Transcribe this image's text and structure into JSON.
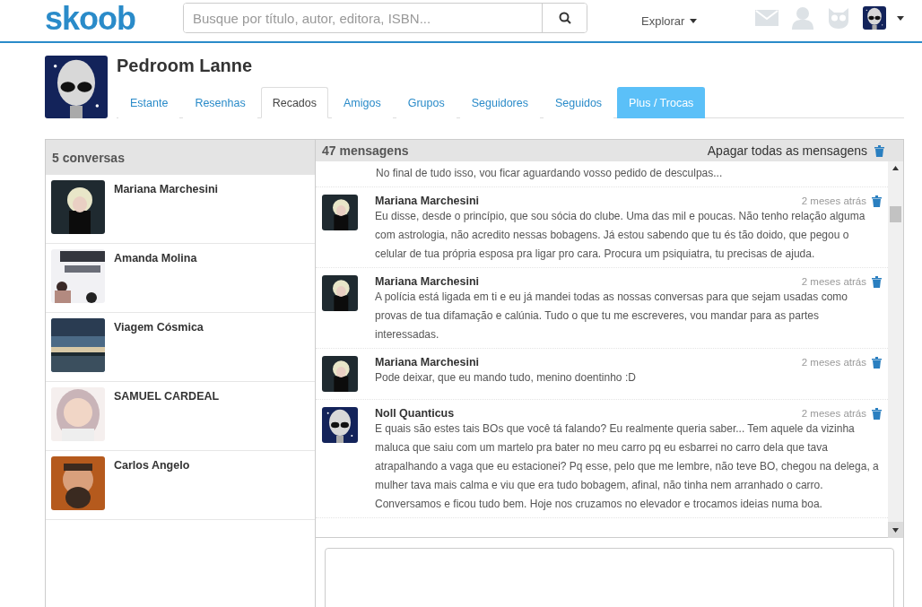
{
  "header": {
    "logo": "skoob",
    "search": {
      "placeholder": "Busque por título, autor, editora, ISBN..."
    },
    "explore": "Explorar"
  },
  "profile": {
    "name": "Pedroom Lanne"
  },
  "tabs": [
    {
      "label": "Estante",
      "selected": false,
      "kind": "normal"
    },
    {
      "label": "Resenhas",
      "selected": false,
      "kind": "normal"
    },
    {
      "label": "Recados",
      "selected": true,
      "kind": "normal"
    },
    {
      "label": "Amigos",
      "selected": false,
      "kind": "normal"
    },
    {
      "label": "Grupos",
      "selected": false,
      "kind": "normal"
    },
    {
      "label": "Seguidores",
      "selected": false,
      "kind": "normal"
    },
    {
      "label": "Seguidos",
      "selected": false,
      "kind": "normal"
    },
    {
      "label": "Plus / Trocas",
      "selected": false,
      "kind": "plus"
    }
  ],
  "conversations": {
    "title": "5 conversas",
    "items": [
      {
        "name": "Mariana Marchesini"
      },
      {
        "name": "Amanda Molina"
      },
      {
        "name": "Viagem Cósmica"
      },
      {
        "name": "SAMUEL CARDEAL"
      },
      {
        "name": "Carlos Angelo"
      }
    ]
  },
  "messages": {
    "title": "47 mensagens",
    "delete_all": "Apagar todas as mensagens",
    "items": [
      {
        "kind": "continued",
        "text": "No final de tudo isso, vou ficar aguardando vosso pedido de desculpas..."
      },
      {
        "kind": "full",
        "author": "Mariana Marchesini",
        "time": "2 meses atrás",
        "text": "Eu disse, desde o princípio, que sou sócia do clube. Uma das mil e poucas. Não tenho relação alguma com astrologia, não acredito nessas bobagens. Já estou sabendo que tu és tão doido, que pegou o celular de tua própria esposa pra ligar pro cara. Procura um psiquiatra, tu precisas de ajuda."
      },
      {
        "kind": "full",
        "author": "Mariana Marchesini",
        "time": "2 meses atrás",
        "text": "A polícia está ligada em ti e eu já mandei todas as nossas conversas para que sejam usadas como provas de tua difamação e calúnia. Tudo o que tu me escreveres, vou mandar para as partes interessadas."
      },
      {
        "kind": "full",
        "author": "Mariana Marchesini",
        "time": "2 meses atrás",
        "text": "Pode deixar, que eu mando tudo, menino doentinho :D"
      },
      {
        "kind": "full",
        "author": "Noll Quanticus",
        "time": "2 meses atrás",
        "text": "E quais são estes tais BOs que você tá falando? Eu realmente queria saber... Tem aquele da vizinha maluca que saiu com um martelo pra bater no meu carro pq eu esbarrei no carro dela que tava atrapalhando a vaga que eu estacionei? Pq esse, pelo que me lembre, não teve BO, chegou na delega, a mulher tava mais calma e viu que era tudo bobagem, afinal, não tinha nem arranhado o carro. Conversamos e ficou tudo bem. Hoje nos cruzamos no elevador e trocamos ideias numa boa."
      }
    ]
  }
}
